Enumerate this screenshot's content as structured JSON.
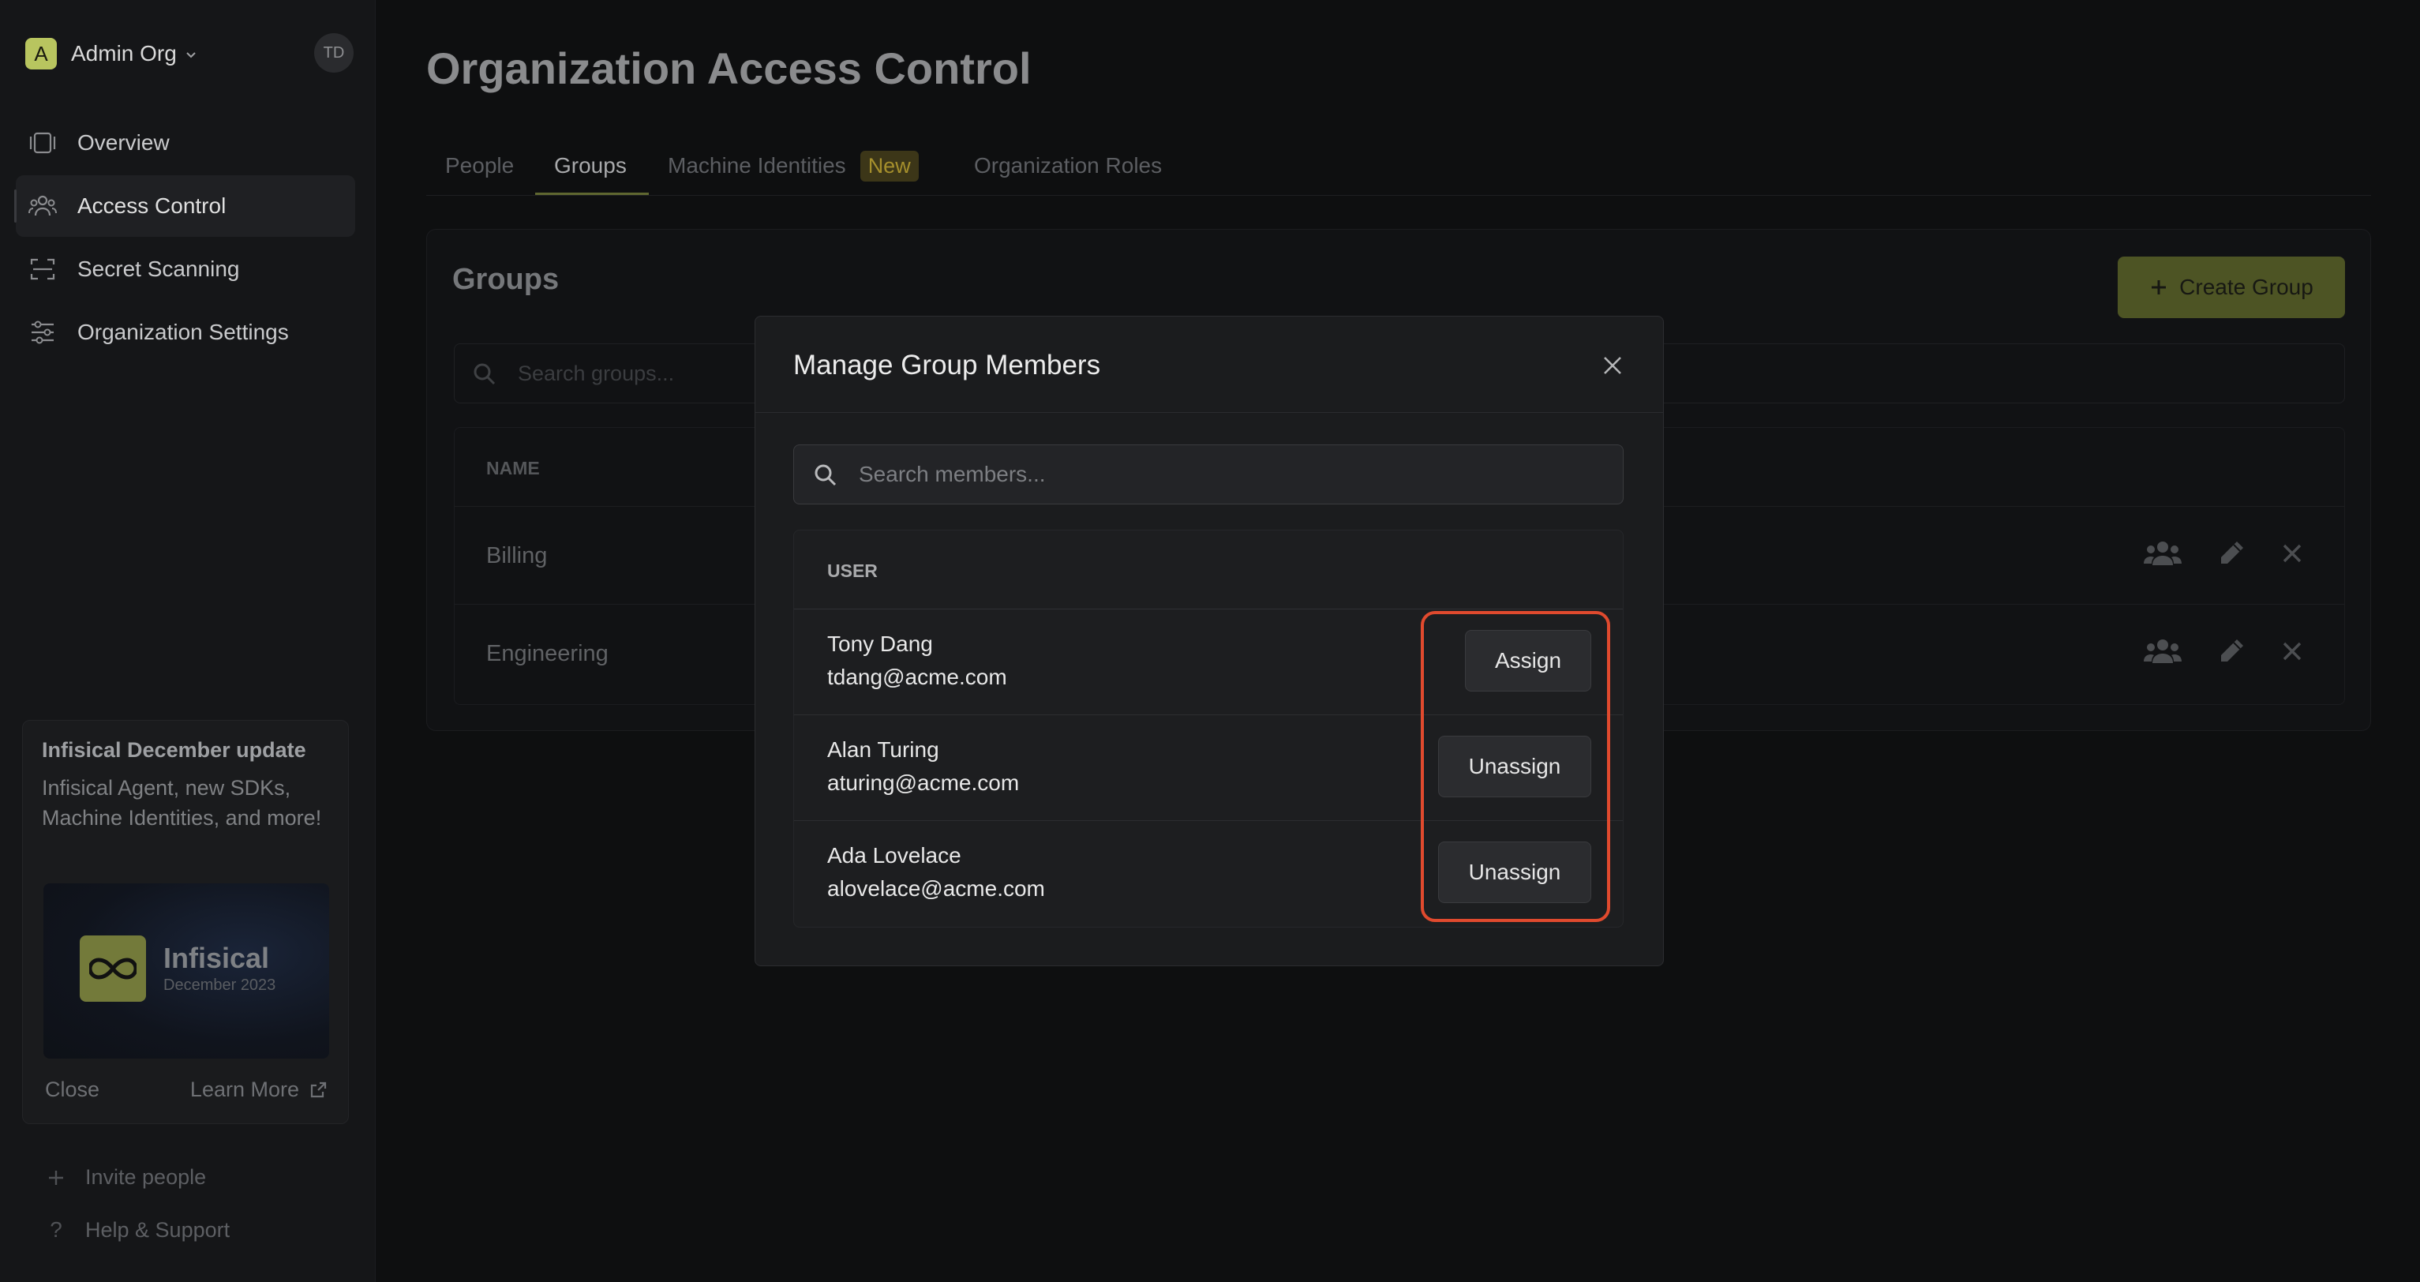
{
  "sidebar": {
    "org_initial": "A",
    "org_name": "Admin Org",
    "user_initials": "TD",
    "nav": [
      {
        "label": "Overview",
        "icon": "overview-icon"
      },
      {
        "label": "Access Control",
        "icon": "users-icon",
        "active": true
      },
      {
        "label": "Secret Scanning",
        "icon": "scan-icon"
      },
      {
        "label": "Organization Settings",
        "icon": "settings-sliders-icon"
      }
    ],
    "update": {
      "title": "Infisical December update",
      "body": "Infisical Agent, new SDKs, Machine Identities, and more!",
      "brand": "Infisical",
      "date": "December 2023",
      "close_label": "Close",
      "learn_more_label": "Learn More"
    },
    "invite_label": "Invite people",
    "help_label": "Help & Support"
  },
  "main": {
    "title": "Organization Access Control",
    "tabs": [
      {
        "label": "People"
      },
      {
        "label": "Groups",
        "active": true
      },
      {
        "label": "Machine Identities",
        "badge": "New"
      },
      {
        "label": "Organization Roles"
      }
    ],
    "groups": {
      "title": "Groups",
      "create_label": "Create Group",
      "search_placeholder": "Search groups...",
      "column_name": "NAME",
      "rows": [
        {
          "name": "Billing"
        },
        {
          "name": "Engineering"
        }
      ]
    }
  },
  "modal": {
    "title": "Manage Group Members",
    "search_placeholder": "Search members...",
    "column_user": "USER",
    "members": [
      {
        "name": "Tony Dang",
        "email": "tdang@acme.com",
        "action": "Assign"
      },
      {
        "name": "Alan Turing",
        "email": "aturing@acme.com",
        "action": "Unassign"
      },
      {
        "name": "Ada Lovelace",
        "email": "alovelace@acme.com",
        "action": "Unassign"
      }
    ]
  },
  "colors": {
    "accent": "#b8c55f",
    "highlight": "#e04a2e",
    "badge_bg": "#3c3618"
  }
}
